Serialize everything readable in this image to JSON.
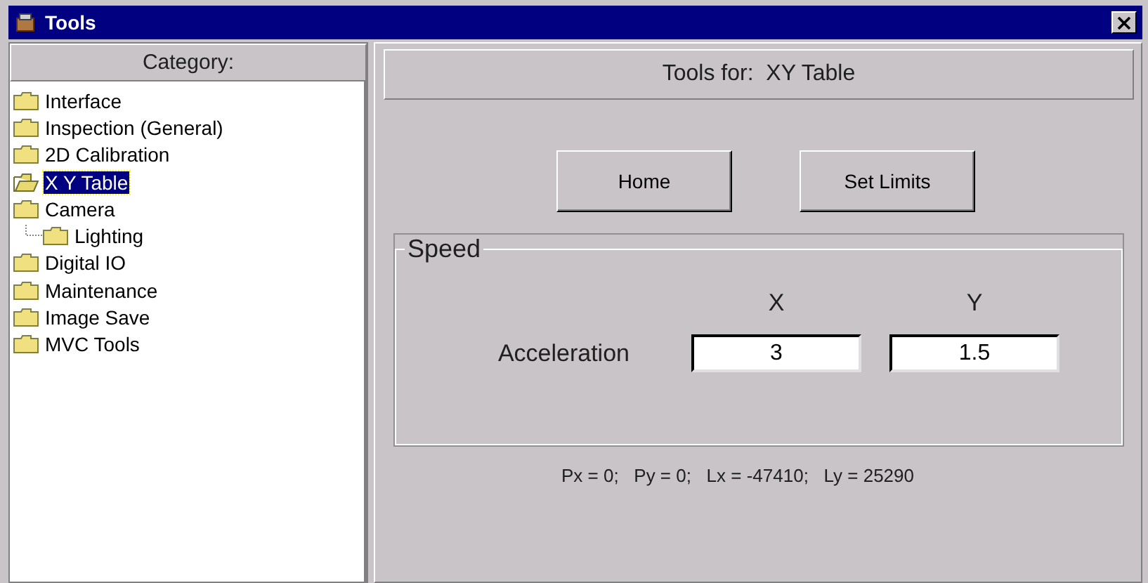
{
  "window": {
    "title": "Tools"
  },
  "category": {
    "header": "Category:",
    "items": [
      {
        "label": "Interface",
        "selected": false
      },
      {
        "label": "Inspection (General)",
        "selected": false
      },
      {
        "label": "2D Calibration",
        "selected": false
      },
      {
        "label": "X Y Table",
        "selected": true
      },
      {
        "label": "Camera",
        "selected": false,
        "children": [
          {
            "label": "Lighting",
            "selected": false
          }
        ]
      },
      {
        "label": "Digital IO",
        "selected": false
      },
      {
        "label": "Maintenance",
        "selected": false
      },
      {
        "label": "Image Save",
        "selected": false
      },
      {
        "label": "MVC Tools",
        "selected": false
      }
    ]
  },
  "tools": {
    "header": "Tools for:  XY Table",
    "buttons": [
      "Home",
      "Set Limits"
    ],
    "speed": {
      "title": "Speed",
      "columns": [
        "X",
        "Y"
      ],
      "row_label": "Acceleration",
      "values": [
        "3",
        "1.5"
      ]
    },
    "status": "Px = 0;   Py = 0;   Lx = -47410;   Ly = 25290"
  }
}
